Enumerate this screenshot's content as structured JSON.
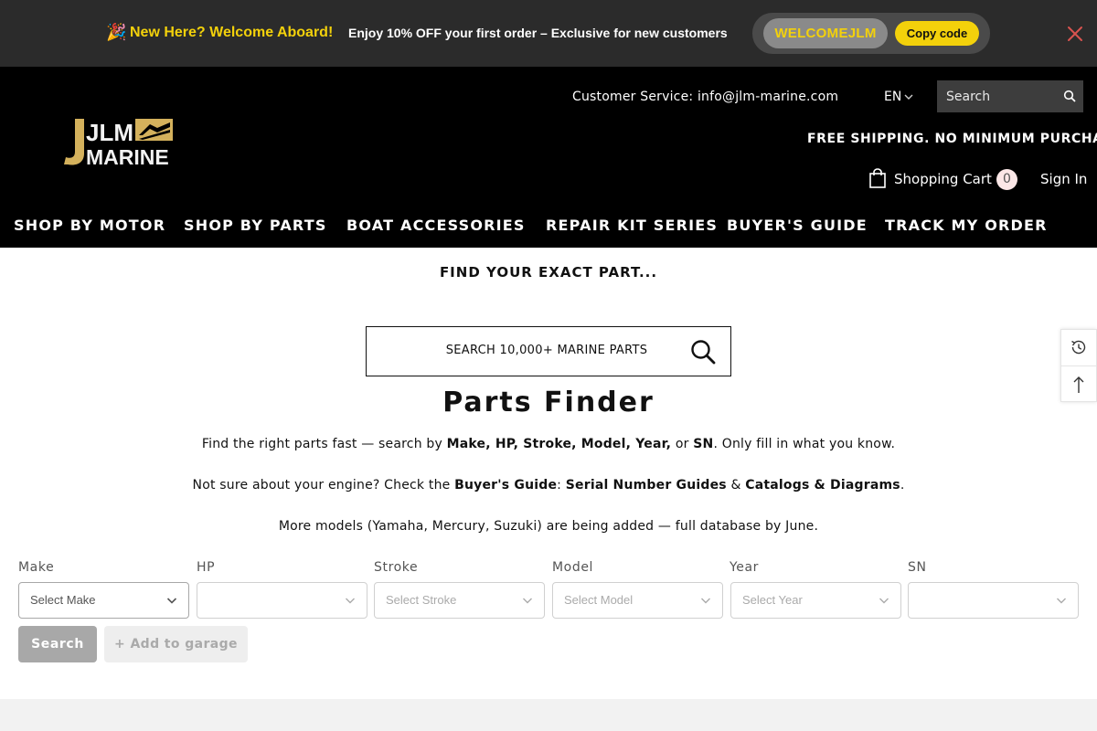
{
  "announcement": {
    "emoji": "🎉",
    "welcome": "New Here? Welcome Aboard!",
    "offer": "Enjoy 10% OFF your first order – Exclusive for new customers",
    "code": "WELCOMEJLM",
    "copy_label": "Copy code"
  },
  "header": {
    "logo_top": "JLM",
    "logo_bottom": "MARINE",
    "customer_service": "Customer Service: info@jlm-marine.com",
    "language": "EN",
    "search_placeholder": "Search",
    "shipping_note": "FREE SHIPPING. NO MINIMUM PURCHASE",
    "cart_label": "Shopping Cart",
    "cart_count": "0",
    "signin_label": "Sign In"
  },
  "nav": {
    "items": [
      "SHOP BY MOTOR",
      "SHOP BY PARTS",
      "BOAT ACCESSORIES",
      "REPAIR KIT SERIES",
      "BUYER'S GUIDE",
      "TRACK MY ORDER"
    ]
  },
  "main": {
    "find_title": "FIND YOUR EXACT PART...",
    "search_label": "SEARCH 10,000+ MARINE PARTS",
    "title": "Parts Finder",
    "line1_pre": "Find the right parts fast — search by",
    "line1_bold": "Make, HP, Stroke, Model, Year,",
    "line1_or": "or",
    "line1_sn": "SN",
    "line1_post": ". Only fill in what you know.",
    "line2_pre": "Not sure about your engine? Check the",
    "line2_guide": "Buyer's Guide",
    "line2_colon": ":",
    "line2_serial": "Serial Number Guides",
    "line2_amp": "&",
    "line2_catalogs": "Catalogs & Diagrams",
    "line2_post": ".",
    "line3": "More models (Yamaha, Mercury, Suzuki) are being added — full database by June."
  },
  "finder": {
    "fields": [
      {
        "label": "Make",
        "value": "Select Make"
      },
      {
        "label": "HP",
        "value": ""
      },
      {
        "label": "Stroke",
        "value": "Select Stroke"
      },
      {
        "label": "Model",
        "value": "Select Model"
      },
      {
        "label": "Year",
        "value": "Select Year"
      },
      {
        "label": "SN",
        "value": ""
      }
    ],
    "search_button": "Search",
    "garage_button": "+ Add to garage"
  },
  "colors": {
    "accent_yellow": "#f3d10b",
    "promo_bg": "#2b2b2b",
    "header_bg": "#000000",
    "disabled_button": "#a8a8a8"
  },
  "icons": {
    "close": "close-icon",
    "search": "search-icon",
    "cart": "shopping-bag-icon",
    "recent": "history-icon",
    "back_to_top": "arrow-up-icon",
    "chevron": "chevron-down-icon"
  }
}
